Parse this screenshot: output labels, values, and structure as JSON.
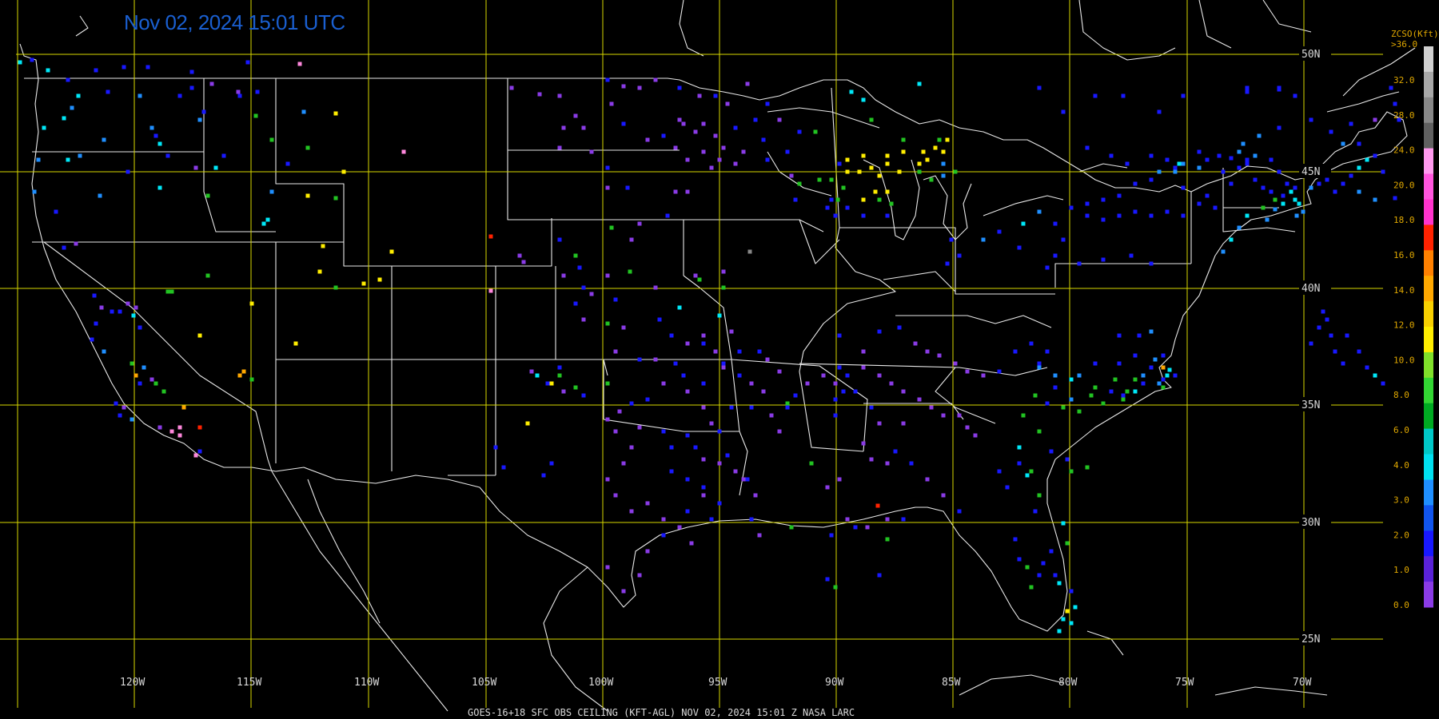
{
  "timestamp": "Nov 02, 2024 15:01 UTC",
  "footer": "GOES-16+18  SFC OBS CEILING (KFT-AGL)   NOV 02, 2024 15:01 Z   NASA LARC",
  "legend": {
    "title": "ZCSO(Kft)",
    "max_label": ">36.0",
    "tick_labels": [
      "32.0",
      "28.0",
      "24.0",
      "20.0",
      "18.0",
      "16.0",
      "14.0",
      "12.0",
      "10.0",
      "8.0",
      "6.0",
      "4.0",
      "3.0",
      "2.0",
      "1.0",
      "0.0"
    ],
    "bands": [
      "#8a3be6",
      "#5a22d8",
      "#1818ff",
      "#1155ee",
      "#1f8fff",
      "#00e0f0",
      "#00c8c8",
      "#00aa22",
      "#33d633",
      "#80e02a",
      "#ffee00",
      "#f8d000",
      "#ffa800",
      "#ff8000",
      "#ff2200",
      "#ff33cc",
      "#ff55dd",
      "#ff99ee",
      "#606060",
      "#888888",
      "#a8a8a8",
      "#d0d0d0"
    ]
  },
  "grid": {
    "lon_labels": [
      "120W",
      "115W",
      "110W",
      "105W",
      "100W",
      "95W",
      "90W",
      "85W",
      "80W",
      "75W",
      "70W"
    ],
    "lat_labels": [
      "50N",
      "45N",
      "40N",
      "35N",
      "30N",
      "25N"
    ]
  },
  "colors": {
    "grid": "#d8d800",
    "borders": "#e8e8e8",
    "background": "#000000",
    "timestamp": "#1a5fd0"
  },
  "obs_palette": {
    "p": "#8a3be6",
    "b": "#1818ff",
    "l": "#1f8fff",
    "c": "#00e8f8",
    "g": "#22c322",
    "y": "#ffee00",
    "o": "#ffa800",
    "r": "#ff2200",
    "k": "#ff88dd",
    "x": "#888888"
  }
}
